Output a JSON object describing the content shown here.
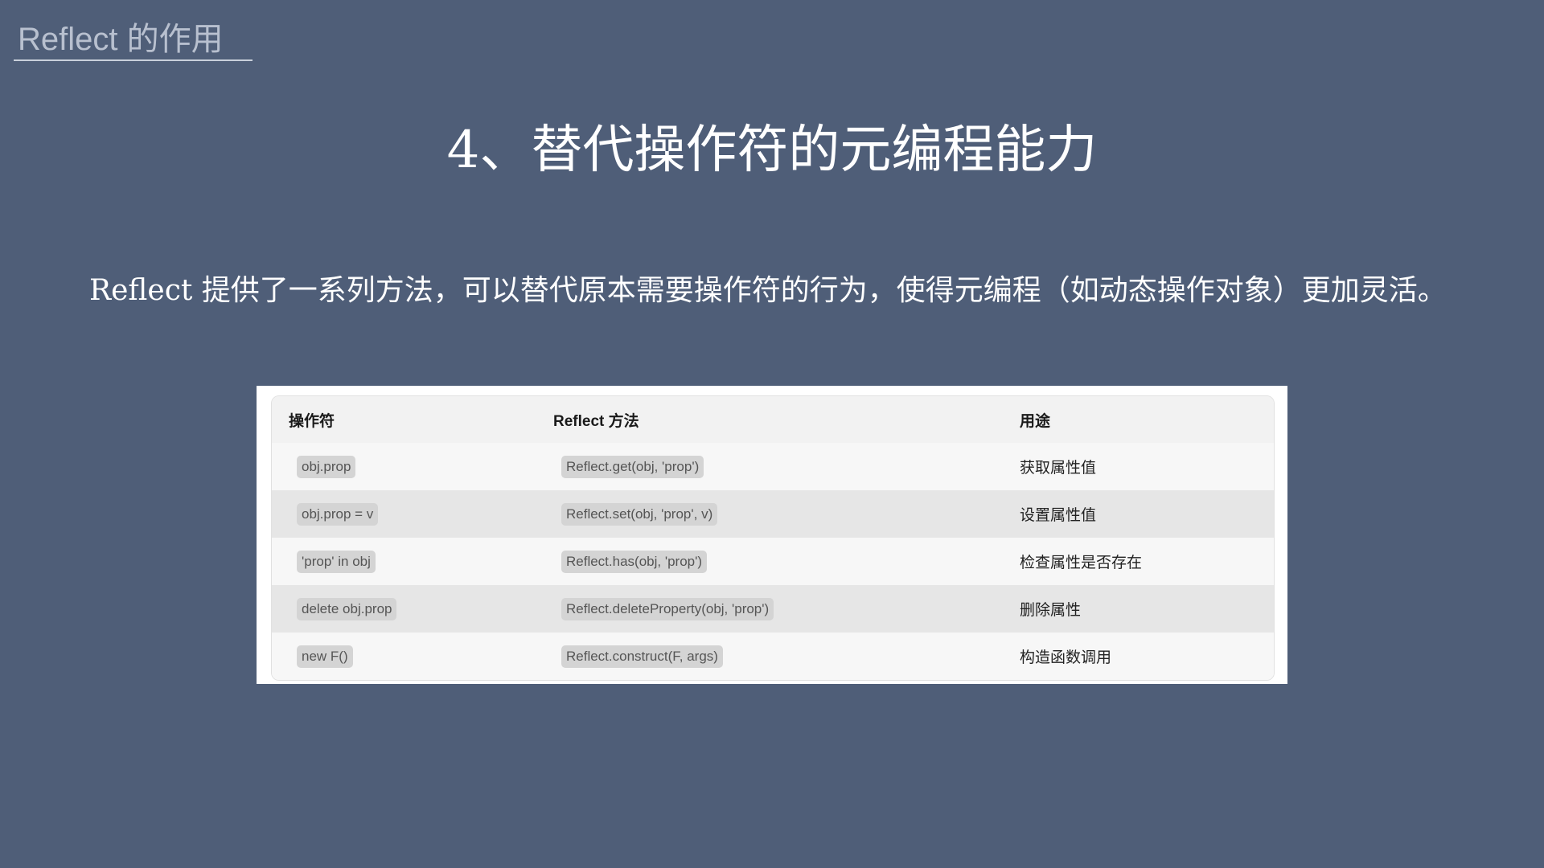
{
  "header": {
    "label": "Reflect 的作用"
  },
  "title": "4、替代操作符的元编程能力",
  "description": "Reflect 提供了一系列方法，可以替代原本需要操作符的行为，使得元编程（如动态操作对象）更加灵活。",
  "table": {
    "columns": [
      "操作符",
      "Reflect 方法",
      "用途"
    ],
    "rows": [
      {
        "operator": "obj.prop",
        "method": "Reflect.get(obj, 'prop')",
        "usage": "获取属性值"
      },
      {
        "operator": "obj.prop = v",
        "method": "Reflect.set(obj, 'prop', v)",
        "usage": "设置属性值"
      },
      {
        "operator": "'prop' in obj",
        "method": "Reflect.has(obj, 'prop')",
        "usage": "检查属性是否存在"
      },
      {
        "operator": "delete obj.prop",
        "method": "Reflect.deleteProperty(obj, 'prop')",
        "usage": "删除属性"
      },
      {
        "operator": "new F()",
        "method": "Reflect.construct(F, args)",
        "usage": "构造函数调用"
      }
    ]
  }
}
